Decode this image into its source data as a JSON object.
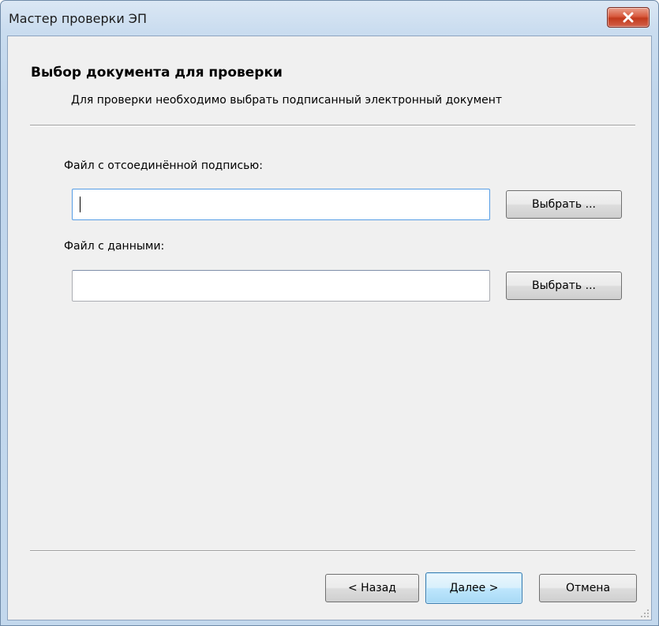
{
  "window": {
    "title": "Мастер проверки ЭП"
  },
  "header": {
    "title": "Выбор документа для проверки",
    "subtitle": "Для проверки необходимо выбрать подписанный электронный документ"
  },
  "form": {
    "signature_file": {
      "label": "Файл с отсоединённой подписью:",
      "value": "",
      "browse_label": "Выбрать ..."
    },
    "data_file": {
      "label": "Файл с данными:",
      "value": "",
      "browse_label": "Выбрать ..."
    }
  },
  "footer": {
    "back_label": "< Назад",
    "next_label": "Далее >",
    "cancel_label": "Отмена"
  },
  "colors": {
    "close_button": "#c23a1c",
    "default_button_border": "#3c7fb1",
    "client_background": "#f0f0f0"
  }
}
